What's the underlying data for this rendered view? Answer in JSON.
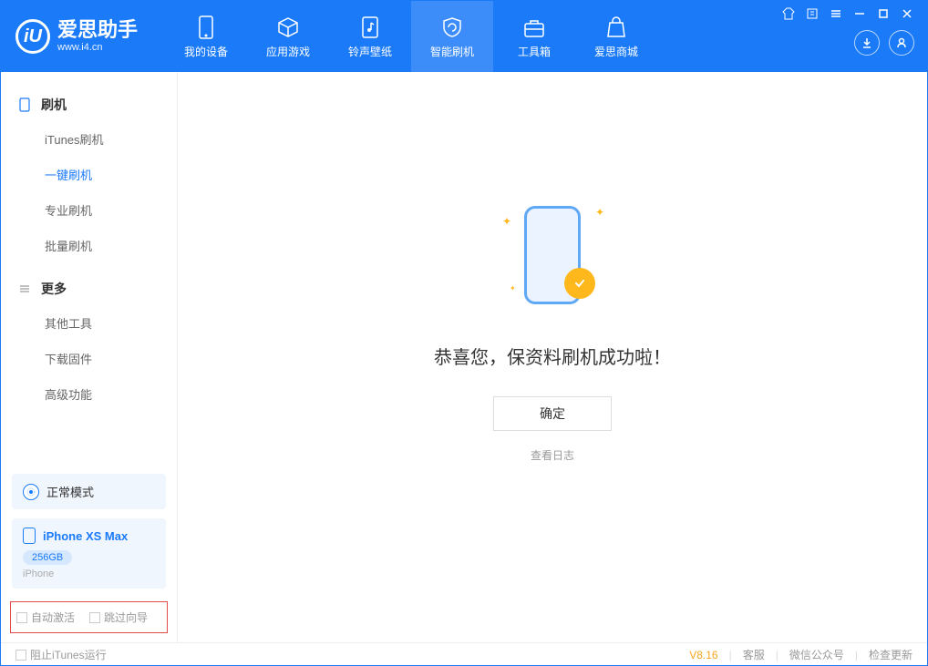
{
  "logo": {
    "mark": "iU",
    "title": "爱思助手",
    "subtitle": "www.i4.cn"
  },
  "nav": {
    "tabs": [
      {
        "label": "我的设备"
      },
      {
        "label": "应用游戏"
      },
      {
        "label": "铃声壁纸"
      },
      {
        "label": "智能刷机"
      },
      {
        "label": "工具箱"
      },
      {
        "label": "爱思商城"
      }
    ]
  },
  "sidebar": {
    "group1": {
      "title": "刷机",
      "items": [
        {
          "label": "iTunes刷机"
        },
        {
          "label": "一键刷机"
        },
        {
          "label": "专业刷机"
        },
        {
          "label": "批量刷机"
        }
      ]
    },
    "group2": {
      "title": "更多",
      "items": [
        {
          "label": "其他工具"
        },
        {
          "label": "下载固件"
        },
        {
          "label": "高级功能"
        }
      ]
    }
  },
  "mode": {
    "label": "正常模式"
  },
  "device": {
    "name": "iPhone XS Max",
    "capacity": "256GB",
    "type": "iPhone"
  },
  "checkboxes": {
    "auto_activate": "自动激活",
    "skip_guide": "跳过向导"
  },
  "main": {
    "success_text": "恭喜您，保资料刷机成功啦！",
    "confirm": "确定",
    "view_log": "查看日志"
  },
  "footer": {
    "block_itunes": "阻止iTunes运行",
    "version": "V8.16",
    "support": "客服",
    "wechat": "微信公众号",
    "check_update": "检查更新"
  }
}
